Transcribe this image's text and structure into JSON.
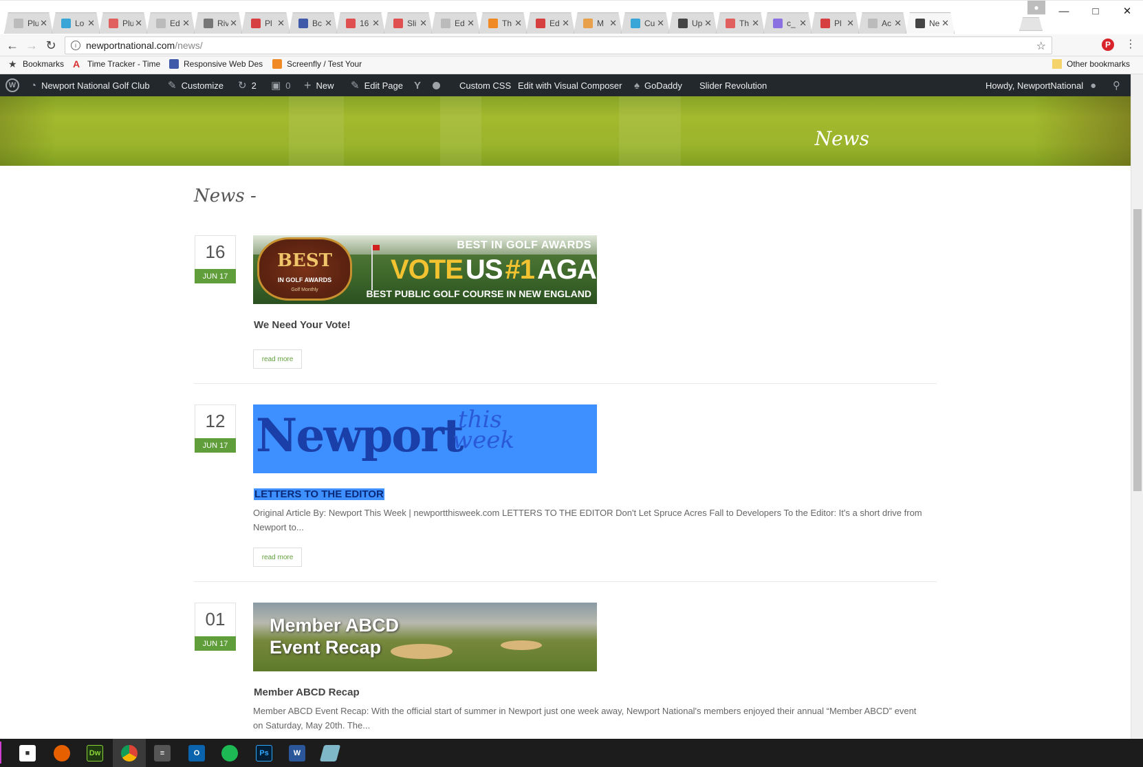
{
  "browser": {
    "tabs": [
      {
        "title": "Plu",
        "color": "#bbbbbb"
      },
      {
        "title": "Lo",
        "color": "#3aa6d8"
      },
      {
        "title": "Plu",
        "color": "#e06060"
      },
      {
        "title": "Ed",
        "color": "#bbbbbb"
      },
      {
        "title": "Riv",
        "color": "#777777"
      },
      {
        "title": "Pl",
        "color": "#d64040"
      },
      {
        "title": "Bc",
        "color": "#3e5aa8"
      },
      {
        "title": "16",
        "color": "#e05050"
      },
      {
        "title": "Sli",
        "color": "#e05050"
      },
      {
        "title": "Ed",
        "color": "#bbbbbb"
      },
      {
        "title": "Th",
        "color": "#f08a24"
      },
      {
        "title": "Ed",
        "color": "#d64040"
      },
      {
        "title": "M",
        "color": "#e8a04a"
      },
      {
        "title": "Cu",
        "color": "#3aa6d8"
      },
      {
        "title": "Up",
        "color": "#444444"
      },
      {
        "title": "Th",
        "color": "#e06060"
      },
      {
        "title": "c_",
        "color": "#8a70e0"
      },
      {
        "title": "Pl",
        "color": "#d64040"
      },
      {
        "title": "Ac",
        "color": "#bbbbbb"
      },
      {
        "title": "Ne",
        "color": "#444444"
      }
    ],
    "close_glyph": "✕",
    "url_domain": "newportnational.com",
    "url_path": "/news/",
    "bookmarks": [
      {
        "label": "Bookmarks",
        "color": "#444444"
      },
      {
        "label": "Time Tracker - Time",
        "color": "#d83030"
      },
      {
        "label": "Responsive Web Desi",
        "color": "#3e5aa8"
      },
      {
        "label": "Screenfly / Test Your",
        "color": "#f08a24"
      }
    ],
    "other_bookmarks": "Other bookmarks"
  },
  "wpbar": {
    "site_name": "Newport National Golf Club",
    "customize": "Customize",
    "updates_count": "2",
    "comments_count": "0",
    "new": "New",
    "edit_page": "Edit Page",
    "custom_css": "Custom CSS",
    "visual_composer": "Edit with Visual Composer",
    "godaddy": "GoDaddy",
    "slider": "Slider Revolution",
    "howdy": "Howdy, NewportNational"
  },
  "page": {
    "hero_title": "News",
    "heading": "News -",
    "read_more": "read more",
    "posts": [
      {
        "day": "16",
        "month": "JUN 17",
        "title": "We Need Your Vote!",
        "excerpt": "",
        "banner": {
          "award_top": "BEST",
          "award_sub": "IN GOLF AWARDS",
          "award_small": "Golf Monthly",
          "line1": "BEST IN GOLF AWARDS",
          "vote": "VOTE",
          "us": "US",
          "num": "#1",
          "again": "AGAIN!",
          "line3": "BEST PUBLIC GOLF COURSE IN NEW ENGLAND"
        }
      },
      {
        "day": "12",
        "month": "JUN 17",
        "title": "LETTERS TO THE EDITOR",
        "excerpt": "Original Article By: Newport This Week | newportthisweek.com   LETTERS TO THE EDITOR Don't Let Spruce Acres Fall to Developers To the Editor: It's a short drive from Newport to...",
        "banner": {
          "logo": "Newport",
          "this": "this",
          "week": "week"
        }
      },
      {
        "day": "01",
        "month": "JUN 17",
        "title": "Member ABCD Recap",
        "excerpt": "Member ABCD Event Recap: With the official start of summer in Newport just one week away, Newport National's members enjoyed their annual “Member ABCD” event on Saturday, May 20th. The...",
        "banner": {
          "line1": "Member ABCD",
          "line2": "Event Recap"
        }
      }
    ]
  },
  "taskbar": {
    "dreamweaver": "Dw",
    "photoshop": "Ps",
    "word": "W"
  }
}
